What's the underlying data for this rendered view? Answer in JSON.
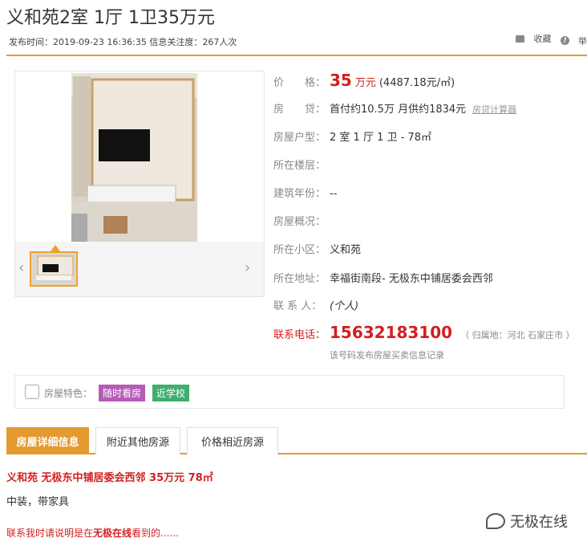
{
  "header": {
    "title": "义和苑2室 1厅 1卫35万元",
    "meta": "发布时间：2019-09-23 16:36:35 信息关注度：267人次",
    "actions": [
      {
        "label": "收藏",
        "icon": "folder-icon"
      },
      {
        "label": "举",
        "icon": "warning-icon"
      }
    ]
  },
  "info": {
    "price_label": "价　　格：",
    "price_value": "35",
    "price_unit": "万元",
    "price_per": "(4487.18元/㎡)",
    "loan_label": "房　　贷：",
    "loan_value": "首付约10.5万 月供约1834元",
    "loan_calc": "房贷计算器",
    "type_label": "房屋户型：",
    "type_value": "2 室 1 厅 1 卫 - 78㎡",
    "floor_label": "所在楼层：",
    "floor_value": "",
    "year_label": "建筑年份：",
    "year_value": "--",
    "overview_label": "房屋概况：",
    "overview_value": "",
    "community_label": "所在小区：",
    "community_value": "义和苑",
    "address_label": "所在地址：",
    "address_value": "幸福街南段- 无极东中铺居委会西邻",
    "contact_label": "联 系 人：",
    "contact_value": "(个人)",
    "phone_label": "联系电话：",
    "phone_value": "15632183100",
    "phone_location": "（ 归属地：河北 石家庄市 ）",
    "phone_note": "该号码发布房屋买卖信息记录"
  },
  "features": {
    "label": "房屋特色：",
    "tags": [
      "随时看房",
      "近学校"
    ]
  },
  "tabs": [
    "房屋详细信息",
    "附近其他房源",
    "价格相近房源"
  ],
  "detail": {
    "title": "义和苑 无极东中铺居委会西邻 35万元 78㎡",
    "description": "中装，带家具",
    "note_prefix": "联系我时请说明是在",
    "note_site": "无极在线",
    "note_suffix": "看到的......"
  },
  "watermark": {
    "text": "无极在线"
  },
  "gallery": {
    "prev_arrow": "‹",
    "next_arrow": "›"
  }
}
